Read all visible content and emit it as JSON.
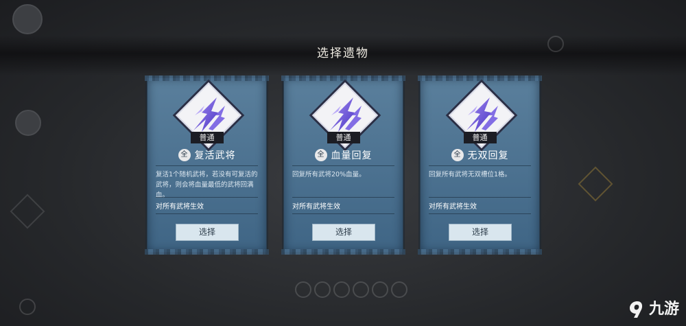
{
  "dialog": {
    "title": "选择遗物"
  },
  "cards": [
    {
      "rarity": "普通",
      "scope_badge": "全",
      "name": "复活武将",
      "description": "复活1个随机武将，若没有可复活的武将，则会将血量最低的武将回满血。",
      "effect_scope": "对所有武将生效",
      "select_label": "选择",
      "icon": "lightning-relic-icon"
    },
    {
      "rarity": "普通",
      "scope_badge": "全",
      "name": "血量回复",
      "description": "回复所有武将20%血量。",
      "effect_scope": "对所有武将生效",
      "select_label": "选择",
      "icon": "lightning-relic-icon"
    },
    {
      "rarity": "普通",
      "scope_badge": "全",
      "name": "无双回复",
      "description": "回复所有武将无双槽位1格。",
      "effect_scope": "对所有武将生效",
      "select_label": "选择",
      "icon": "lightning-relic-icon"
    }
  ],
  "watermark": {
    "text": "九游"
  },
  "colors": {
    "card_top": "#5a7f9c",
    "card_bottom": "#3f6585",
    "button": "#d9e6ee",
    "emblem_frame": "#2b2f45"
  }
}
